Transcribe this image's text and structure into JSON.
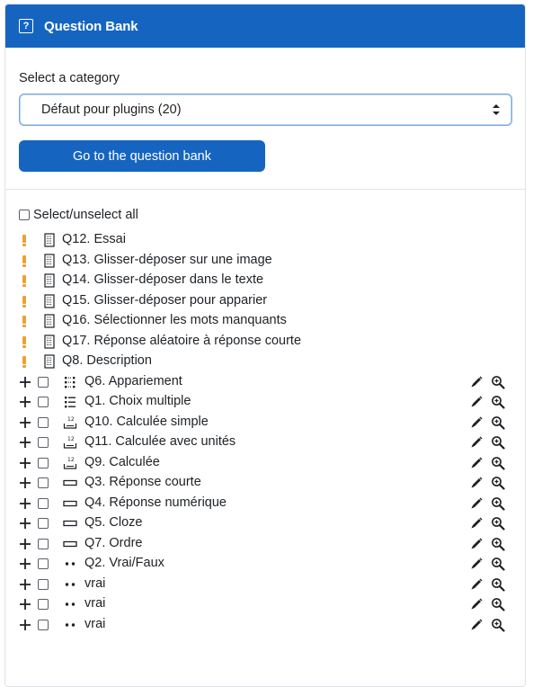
{
  "header": {
    "title": "Question Bank",
    "help_icon": "?"
  },
  "category": {
    "label": "Select a category",
    "selected": "Défaut pour plugins (20)"
  },
  "go_button": "Go to the question bank",
  "select_all_label": "Select/unselect all",
  "static_questions": [
    {
      "text": "Q12. Essai",
      "icon": "warning-icon"
    },
    {
      "text": "Q13. Glisser-déposer sur une image",
      "icon": "warning-icon"
    },
    {
      "text": "Q14. Glisser-déposer dans le texte",
      "icon": "warning-icon"
    },
    {
      "text": "Q15. Glisser-déposer pour apparier",
      "icon": "warning-icon"
    },
    {
      "text": "Q16. Sélectionner les mots manquants",
      "icon": "warning-icon"
    },
    {
      "text": "Q17. Réponse aléatoire à réponse courte",
      "icon": "warning-icon"
    },
    {
      "text": "Q8. Description",
      "icon": "warning-icon"
    }
  ],
  "questions": [
    {
      "text": "Q6. Appariement",
      "type": "matching"
    },
    {
      "text": "Q1. Choix multiple",
      "type": "multichoice"
    },
    {
      "text": "Q10. Calculée simple",
      "type": "calculated"
    },
    {
      "text": "Q11. Calculée avec unités",
      "type": "calculated"
    },
    {
      "text": "Q9. Calculée",
      "type": "calculated"
    },
    {
      "text": "Q3. Réponse courte",
      "type": "shortanswer"
    },
    {
      "text": "Q4. Réponse numérique",
      "type": "shortanswer"
    },
    {
      "text": "Q5. Cloze",
      "type": "shortanswer"
    },
    {
      "text": "Q7. Ordre",
      "type": "shortanswer"
    },
    {
      "text": "Q2. Vrai/Faux",
      "type": "truefalse"
    },
    {
      "text": "vrai",
      "type": "truefalse"
    },
    {
      "text": "vrai",
      "type": "truefalse"
    },
    {
      "text": "vrai",
      "type": "truefalse"
    }
  ],
  "colors": {
    "primary": "#1565c0",
    "warning": "#f0a030",
    "text": "#1d2125"
  }
}
